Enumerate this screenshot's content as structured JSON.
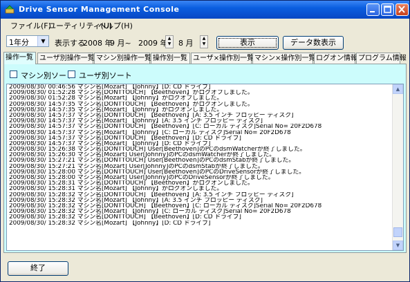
{
  "window": {
    "title": "Drive Sensor Management Console",
    "controls": {
      "minimize": "_",
      "maximize": "□",
      "close": "×"
    }
  },
  "menu": [
    {
      "label": "ファイル(F)"
    },
    {
      "label": "ユーティリティ(U)"
    },
    {
      "label": "ヘルプ(H)"
    }
  ],
  "toolbar": {
    "range_select": "1年分",
    "display_label": "表示する",
    "year1": "2008 年",
    "month1": "9 月~",
    "year2": "2009 年",
    "month2": "8 月",
    "show_button": "表示",
    "count_button": "データ数表示"
  },
  "tabs": [
    {
      "label": "操作一覧",
      "active": true
    },
    {
      "label": "ユーザ別操作一覧"
    },
    {
      "label": "マシン別操作一覧"
    },
    {
      "label": "操作別一覧"
    },
    {
      "label": "ユーザ×操作別一覧"
    },
    {
      "label": "マシン×操作別一覧"
    },
    {
      "label": "ログオン情報"
    },
    {
      "label": "プログラム情報"
    }
  ],
  "filters": {
    "machine_sort": "マシン別ソート",
    "user_sort": "ユーザ別ソート"
  },
  "log": [
    "2009/08/30/ 00:46:56 マシン名[Mozart] 【Johnny】[D: CD ドライブ]",
    "2009/08/30/ 01:52:28 マシン名[DONTTOUCH] 【Beethoven】がログオフしました。",
    "2009/08/30/ 01:52:28 マシン名[Mozart] 【Johnny】がログオフしました。",
    "2009/08/30/ 14:57:35 マシン名[DONTTOUCH] 【Beethoven】がログオンしました。",
    "2009/08/30/ 14:57:35 マシン名[Mozart] 【Johnny】がログオンしました。",
    "2009/08/30/ 14:57:37 マシン名[DONTTOUCH] 【Beethoven】[A: 3.5 インチ フロッピー ディスク]",
    "2009/08/30/ 14:57:37 マシン名[Mozart] 【Johnny】[A: 3.5 インチ フロッピー ディスク]",
    "2009/08/30/ 14:57:37 マシン名[DONTTOUCH] 【Beethoven】[C: ローカル ディスク]Serial No= 20F2D678",
    "2009/08/30/ 14:57:37 マシン名[Mozart] 【Johnny】[C: ローカル ディスク]Serial No= 20F2D678",
    "2009/08/30/ 14:57:37 マシン名[DONTTOUCH] 【Beethoven】[D: CD ドライブ]",
    "2009/08/30/ 14:57:37 マシン名[Mozart] 【Johnny】[D: CD ドライブ]",
    "2009/08/30/ 15:26:38 マシン名[DONTTOUCH] User[Beethoven]のPCのdsmWatcherが終了しました。",
    "2009/08/30/ 15:26:30 マシン名[Mozart] User[Johnny]のPCのdsmWatcherが終了しました。",
    "2009/08/30/ 15:27:21 マシン名[DONTTOUCH] User[Beethoven]のPCのdsmStabが終了しました。",
    "2009/08/30/ 15:27:21 マシン名[Mozart] User[Johnny]のPCのdsmStabが終了しました。",
    "2009/08/30/ 15:28:00 マシン名[DONTTOUCH] User[Beethoven]のPCのDriveSensorが終了しました。",
    "2009/08/30/ 15:28:00 マシン名[Mozart] User[Johnny]のPCのDriveSensorが終了しました。",
    "2009/08/30/ 15:28:31 マシン名[DONTTOUCH] 【Beethoven】がログオンしました。",
    "2009/08/30/ 15:28:31 マシン名[Mozart] 【Johnny】がログオンしました。",
    "2009/08/30/ 15:28:32 マシン名[DONTTOUCH] 【Beethoven】[A: 3.5 インチ フロッピー ディスク]",
    "2009/08/30/ 15:28:32 マシン名[Mozart] 【Johnny】[A: 3.5 インチ フロッピー ディスク]",
    "2009/08/30/ 15:28:32 マシン名[DONTTOUCH] 【Beethoven】[C: ローカル ディスク]Serial No= 20F2D678",
    "2009/08/30/ 15:28:32 マシン名[Mozart] 【Johnny】[C: ローカル ディスク]Serial No= 20F2D678",
    "2009/08/30/ 15:28:32 マシン名[DONTTOUCH] 【Beethoven】[D: CD ドライブ]",
    "2009/08/30/ 15:28:32 マシン名[Mozart] 【Johnny】[D: CD ドライブ]"
  ],
  "scrollbar": {
    "up": "▲",
    "down": "▼"
  },
  "footer": {
    "end_button": "終了"
  }
}
